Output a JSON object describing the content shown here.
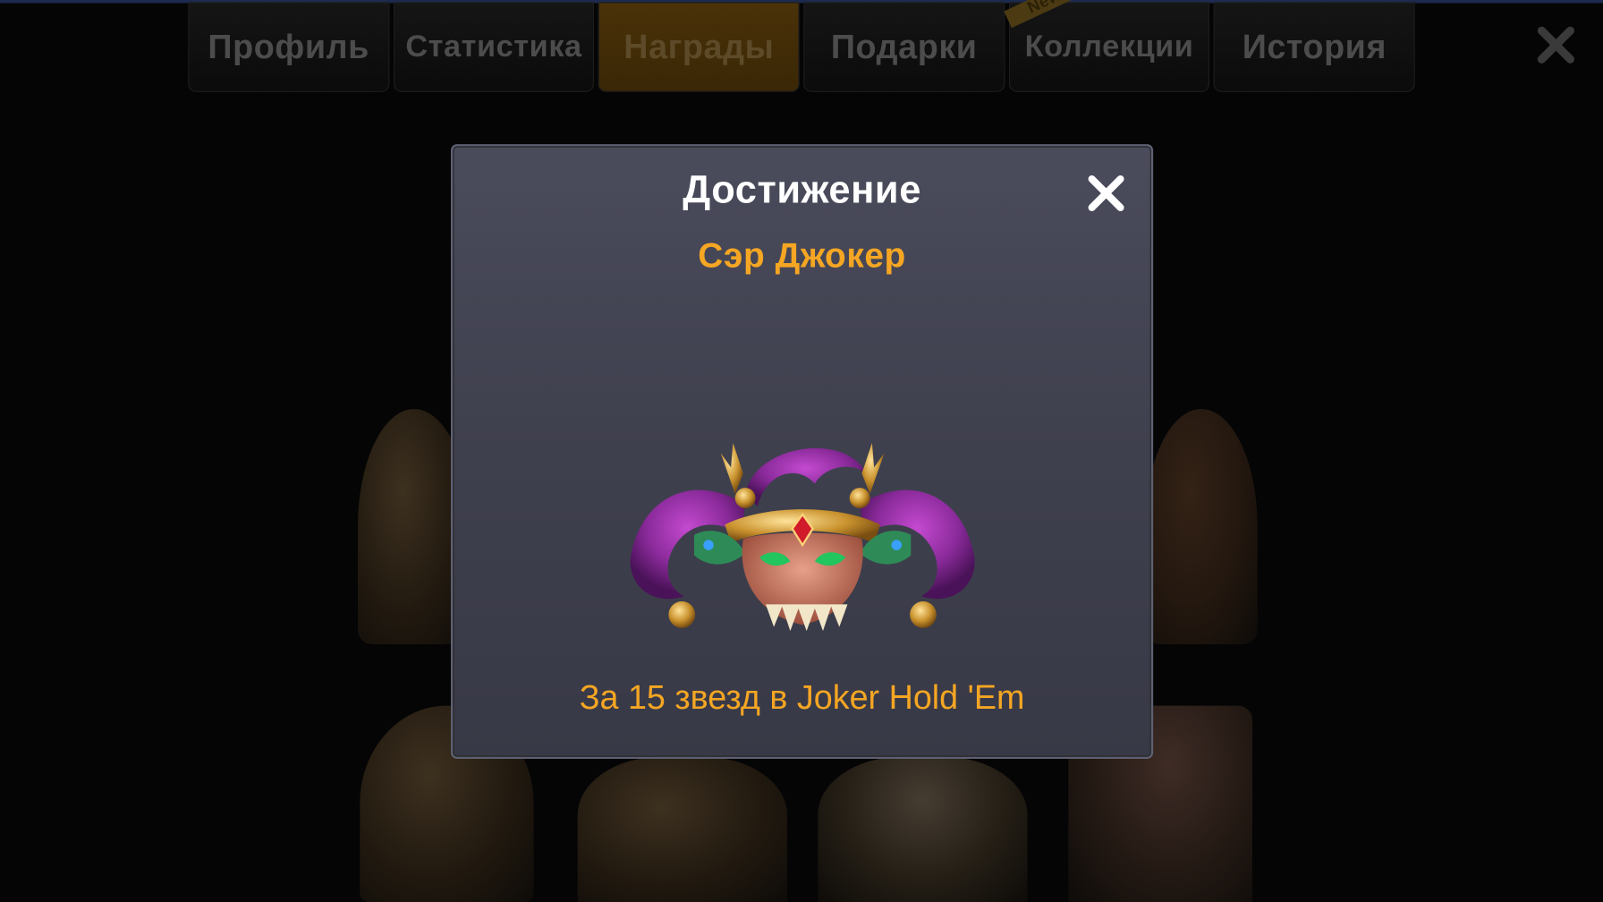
{
  "tabs": [
    {
      "label": "Профиль",
      "active": false
    },
    {
      "label": "Статистика",
      "active": false
    },
    {
      "label": "Награды",
      "active": true
    },
    {
      "label": "Подарки",
      "active": false
    },
    {
      "label": "Коллекции",
      "active": false,
      "badge": "New"
    },
    {
      "label": "История",
      "active": false
    }
  ],
  "main_close_icon": "close-icon",
  "dialog": {
    "title": "Достижение",
    "subtitle": "Сэр Джокер",
    "description": "За 15 звезд в Joker Hold 'Em",
    "close_icon": "close-icon",
    "image_icon": "jester-dragon-mask-icon"
  },
  "colors": {
    "accent": "#f5a623",
    "dialog_bg": "#424352",
    "active_tab": "#3f2b07"
  }
}
